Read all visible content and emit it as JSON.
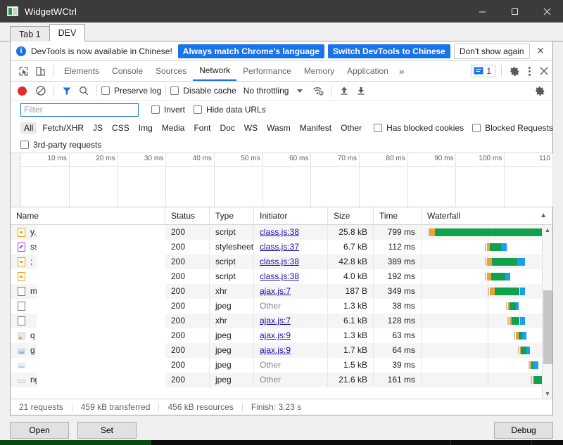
{
  "window": {
    "title": "WidgetWCtrl",
    "icon": "app-icon",
    "minimize": "–",
    "maximize": "□",
    "close": "✕"
  },
  "tabs": [
    {
      "label": "Tab 1",
      "active": false
    },
    {
      "label": "DEV",
      "active": true
    }
  ],
  "infobar": {
    "icon": "info-icon",
    "message": "DevTools is now available in Chinese!",
    "primary_button": "Always match Chrome's language",
    "secondary_button": "Switch DevTools to Chinese",
    "dismiss_button": "Don't show again",
    "close": "✕",
    "accent": "#1a73e8"
  },
  "panel_tabs": {
    "items": [
      {
        "label": "Elements",
        "active": false
      },
      {
        "label": "Console",
        "active": false
      },
      {
        "label": "Sources",
        "active": false
      },
      {
        "label": "Network",
        "active": true
      },
      {
        "label": "Performance",
        "active": false
      },
      {
        "label": "Memory",
        "active": false
      },
      {
        "label": "Application",
        "active": false
      }
    ],
    "overflow": "»",
    "message_count": "1",
    "active_underline": "#1a73e8"
  },
  "network_toolbar": {
    "record_tooltip": "Record",
    "record_color": "#e32b2b",
    "clear_icon": "clear-icon",
    "filter_icon": "filter-icon",
    "search_icon": "search-icon",
    "preserve_log": "Preserve log",
    "disable_cache": "Disable cache",
    "throttling": "No throttling",
    "import_icon": "import-har-icon",
    "export_icon": "export-har-icon",
    "settings_icon": "gear-icon"
  },
  "filter_row": {
    "placeholder": "Filter",
    "value": "",
    "invert": "Invert",
    "hide_data_urls": "Hide data URLs"
  },
  "type_filters": [
    {
      "label": "All",
      "active": true
    },
    {
      "label": "Fetch/XHR",
      "active": false
    },
    {
      "label": "JS",
      "active": false
    },
    {
      "label": "CSS",
      "active": false
    },
    {
      "label": "Img",
      "active": false
    },
    {
      "label": "Media",
      "active": false
    },
    {
      "label": "Font",
      "active": false
    },
    {
      "label": "Doc",
      "active": false
    },
    {
      "label": "WS",
      "active": false
    },
    {
      "label": "Wasm",
      "active": false
    },
    {
      "label": "Manifest",
      "active": false
    },
    {
      "label": "Other",
      "active": false
    }
  ],
  "extra_filters": {
    "has_blocked_cookies": "Has blocked cookies",
    "blocked_requests": "Blocked Requests",
    "third_party_requests": "3rd-party requests"
  },
  "overview": {
    "ticks": [
      "10 ms",
      "20 ms",
      "30 ms",
      "40 ms",
      "50 ms",
      "60 ms",
      "70 ms",
      "80 ms",
      "90 ms",
      "100 ms",
      "110"
    ]
  },
  "table": {
    "columns": [
      "Name",
      "Status",
      "Type",
      "Initiator",
      "Size",
      "Time",
      "Waterfall"
    ],
    "sort_indicator": "▲",
    "rows": [
      {
        "name": "y.js",
        "icon": "js-file-icon",
        "status": "200",
        "type": "script",
        "initiator": "class.js:38",
        "initiator_link": true,
        "size": "25.8 kB",
        "time": "799 ms",
        "bar": {
          "q": 6,
          "o": 4,
          "g": 84,
          "b": 5
        }
      },
      {
        "name": "ss",
        "icon": "css-file-icon",
        "status": "200",
        "type": "stylesheet",
        "initiator": "class.js:37",
        "initiator_link": true,
        "size": "6.7 kB",
        "time": "112 ms",
        "bar": {
          "q": 50,
          "o": 2,
          "g": 9,
          "b": 4
        }
      },
      {
        "name": ";",
        "icon": "js-file-icon",
        "status": "200",
        "type": "script",
        "initiator": "class.js:38",
        "initiator_link": true,
        "size": "42.8 kB",
        "time": "389 ms",
        "bar": {
          "q": 50,
          "o": 4,
          "g": 19,
          "b": 6
        }
      },
      {
        "name": "",
        "icon": "js-file-icon",
        "status": "200",
        "type": "script",
        "initiator": "class.js:38",
        "initiator_link": true,
        "size": "4.0 kB",
        "time": "192 ms",
        "bar": {
          "q": 50,
          "o": 3,
          "g": 11,
          "b": 4
        }
      },
      {
        "name": "m",
        "icon": "generic-file-icon",
        "status": "200",
        "type": "xhr",
        "initiator": "ajax.js:7",
        "initiator_link": true,
        "size": "187 B",
        "time": "349 ms",
        "bar": {
          "q": 52,
          "o": 4,
          "g": 19,
          "b": 4
        }
      },
      {
        "name": "",
        "icon": "generic-file-icon",
        "status": "200",
        "type": "jpeg",
        "initiator": "Other",
        "initiator_link": false,
        "size": "1.3 kB",
        "time": "38 ms",
        "bar": {
          "q": 66,
          "o": 1,
          "g": 5,
          "b": 2
        }
      },
      {
        "name": "",
        "icon": "generic-file-icon",
        "status": "200",
        "type": "xhr",
        "initiator": "ajax.js:7",
        "initiator_link": true,
        "size": "6.1 kB",
        "time": "128 ms",
        "bar": {
          "q": 67,
          "o": 2,
          "g": 6,
          "b": 4
        }
      },
      {
        "name": "q",
        "icon": "image-file-icon",
        "status": "200",
        "type": "jpeg",
        "initiator": "ajax.js:9",
        "initiator_link": true,
        "size": "1.3 kB",
        "time": "63 ms",
        "bar": {
          "q": 72,
          "o": 2,
          "g": 3,
          "b": 3
        }
      },
      {
        "name": "g",
        "icon": "image-file-icon",
        "status": "200",
        "type": "jpeg",
        "initiator": "ajax.js:9",
        "initiator_link": true,
        "size": "1.7 kB",
        "time": "64 ms",
        "bar": {
          "q": 75,
          "o": 1,
          "g": 4,
          "b": 3
        }
      },
      {
        "name": "",
        "icon": "image-file-icon",
        "status": "200",
        "type": "jpeg",
        "initiator": "Other",
        "initiator_link": false,
        "size": "1.5 kB",
        "time": "39 ms",
        "bar": {
          "q": 83,
          "o": 1,
          "g": 1,
          "b": 4
        }
      },
      {
        "name": "ng",
        "icon": "image-file-icon",
        "status": "200",
        "type": "jpeg",
        "initiator": "Other",
        "initiator_link": false,
        "size": "21.6 kB",
        "time": "161 ms",
        "bar": {
          "q": 85,
          "o": 1,
          "g": 6,
          "b": 2
        }
      }
    ],
    "bar_colors": {
      "queueing": "#bdbdbd",
      "waiting": "#f0a22e",
      "download": "#10a24a",
      "stalled": "#1a9ff0"
    }
  },
  "summary": {
    "requests": "21 requests",
    "transferred": "459 kB transferred",
    "resources": "456 kB resources",
    "finish": "Finish: 3.23 s"
  },
  "bottom_buttons": {
    "open": "Open",
    "set": "Set",
    "debug": "Debug"
  }
}
